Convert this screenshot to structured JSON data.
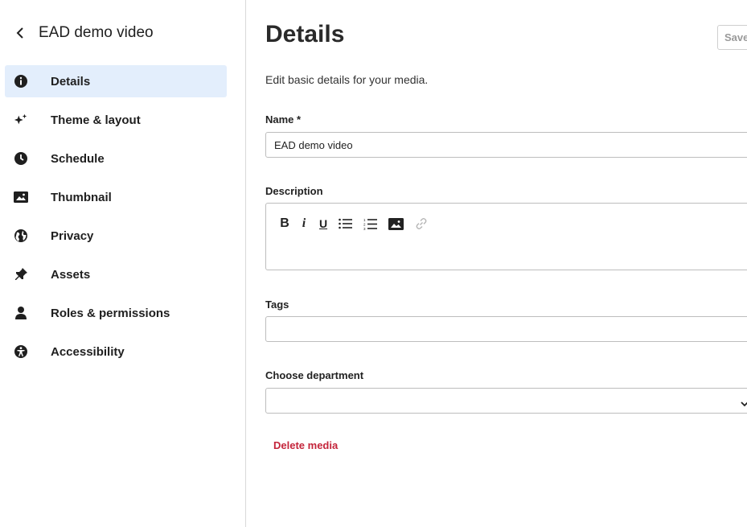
{
  "sidebar": {
    "back_title": "EAD demo video",
    "items": [
      {
        "label": "Details",
        "icon": "info-icon",
        "active": true
      },
      {
        "label": "Theme & layout",
        "icon": "sparkle-icon",
        "active": false
      },
      {
        "label": "Schedule",
        "icon": "clock-icon",
        "active": false
      },
      {
        "label": "Thumbnail",
        "icon": "image-icon",
        "active": false
      },
      {
        "label": "Privacy",
        "icon": "globe-icon",
        "active": false
      },
      {
        "label": "Assets",
        "icon": "pin-icon",
        "active": false
      },
      {
        "label": "Roles & permissions",
        "icon": "user-icon",
        "active": false
      },
      {
        "label": "Accessibility",
        "icon": "accessibility-icon",
        "active": false
      }
    ]
  },
  "main": {
    "title": "Details",
    "save_label": "Save",
    "subtitle": "Edit basic details for your media.",
    "name": {
      "label": "Name *",
      "value": "EAD demo video"
    },
    "description": {
      "label": "Description",
      "toolbar": {
        "bold": "B",
        "italic": "i",
        "underline": "U"
      }
    },
    "tags": {
      "label": "Tags",
      "value": ""
    },
    "department": {
      "label": "Choose department",
      "value": ""
    },
    "delete_label": "Delete media"
  },
  "colors": {
    "active_bg": "#e3eefc",
    "delete": "#c4253b",
    "text": "#222222"
  }
}
